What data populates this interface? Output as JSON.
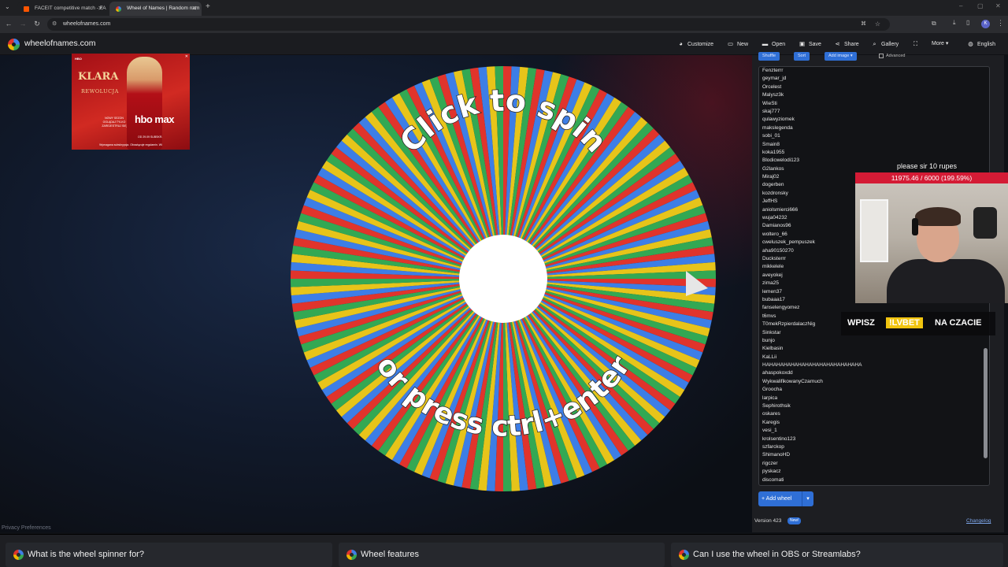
{
  "browser": {
    "tabs": [
      {
        "title": "FACEIT competitive match - FA",
        "active": false
      },
      {
        "title": "Wheel of Names | Random nam",
        "active": true
      }
    ],
    "url": "wheelofnames.com"
  },
  "app": {
    "site_title": "wheelofnames.com",
    "menu": {
      "customize": "Customize",
      "new": "New",
      "open": "Open",
      "save": "Save",
      "share": "Share",
      "gallery": "Gallery",
      "more": "More",
      "language": "English"
    }
  },
  "ad": {
    "brand_top": "HBO",
    "title_line1": "KLARA",
    "title_line2": "REWOLUCJA",
    "badge": "hbo max",
    "side_text": "NOWY SEZON OGLĄDAJ TYLKO ZAREJESTRUJ SIĘ",
    "date": "OD 29.09 SUBSKR.",
    "fine_print": "Wymagana subskrypcja. Obowiązuje regulamin. Wi",
    "close": "✕"
  },
  "privacy": "Privacy Preferences",
  "wheel": {
    "line1": "Click to spin",
    "line2": "or press ctrl+enter",
    "segment_colors": [
      "#e0342c",
      "#3d7ee6",
      "#e7c41a",
      "#33a853"
    ],
    "segment_count": 160
  },
  "panel": {
    "toolbar": {
      "shuffle": "Shuffle",
      "sort": "Sort",
      "add_image": "Add image",
      "advanced": "Advanced"
    },
    "entries": [
      "Fenzterrr",
      "geymar_jd",
      "Orcelest",
      "Malysz3k",
      "WieSti",
      "skaj777",
      "qulawyziomek",
      "makslegenda",
      "sobi_01",
      "Smain8",
      "koka1955",
      "Blodicwelodi123",
      "G2lankos",
      "Miraj02",
      "dogerben",
      "kozdronsky",
      "JeffHS",
      "aniolsmierci666",
      "wuja04232",
      "Damianos96",
      "woltero_66",
      "cweluszek_pempuszek",
      "aha90150270",
      "Ducksterrr",
      "mikkelele",
      "aveyokej",
      "zima25",
      "lemen37",
      "bubaaa17",
      "fanselengyomez",
      "t6mvs",
      "T0mekRzpierdalaczNig",
      "Sinkstar",
      "bunjo",
      "Kielbasin",
      "KaLLii",
      "HAHAHAHAHAHAHAHAHAHAHAHAHAHA",
      "ahaspokoxdd",
      "WykwalifikowanyCzarnuch",
      "Groocha",
      "larpica",
      "Sephirothsik",
      "oskares",
      "Karegis",
      "vesi_1",
      "krolsentino123",
      "szfarckop",
      "ShimanoHD",
      "rigczer",
      "pyskacz",
      "discomati"
    ],
    "add_wheel": "Add wheel",
    "version": "Version 423",
    "new_badge": "New!",
    "changelog": "Changelog"
  },
  "stream": {
    "donation_text": "please sir 10 rupes",
    "donation_progress": "11975.46 / 6000 (199.59%)",
    "donation_fraction": 1.9959,
    "promo_left": "WPISZ",
    "promo_code": "!LVBET",
    "promo_right": "NA CZACIE"
  },
  "faq": [
    {
      "label": "What is the wheel spinner for?"
    },
    {
      "label": "Wheel features"
    },
    {
      "label": "Can I use the wheel in OBS or Streamlabs?"
    }
  ]
}
